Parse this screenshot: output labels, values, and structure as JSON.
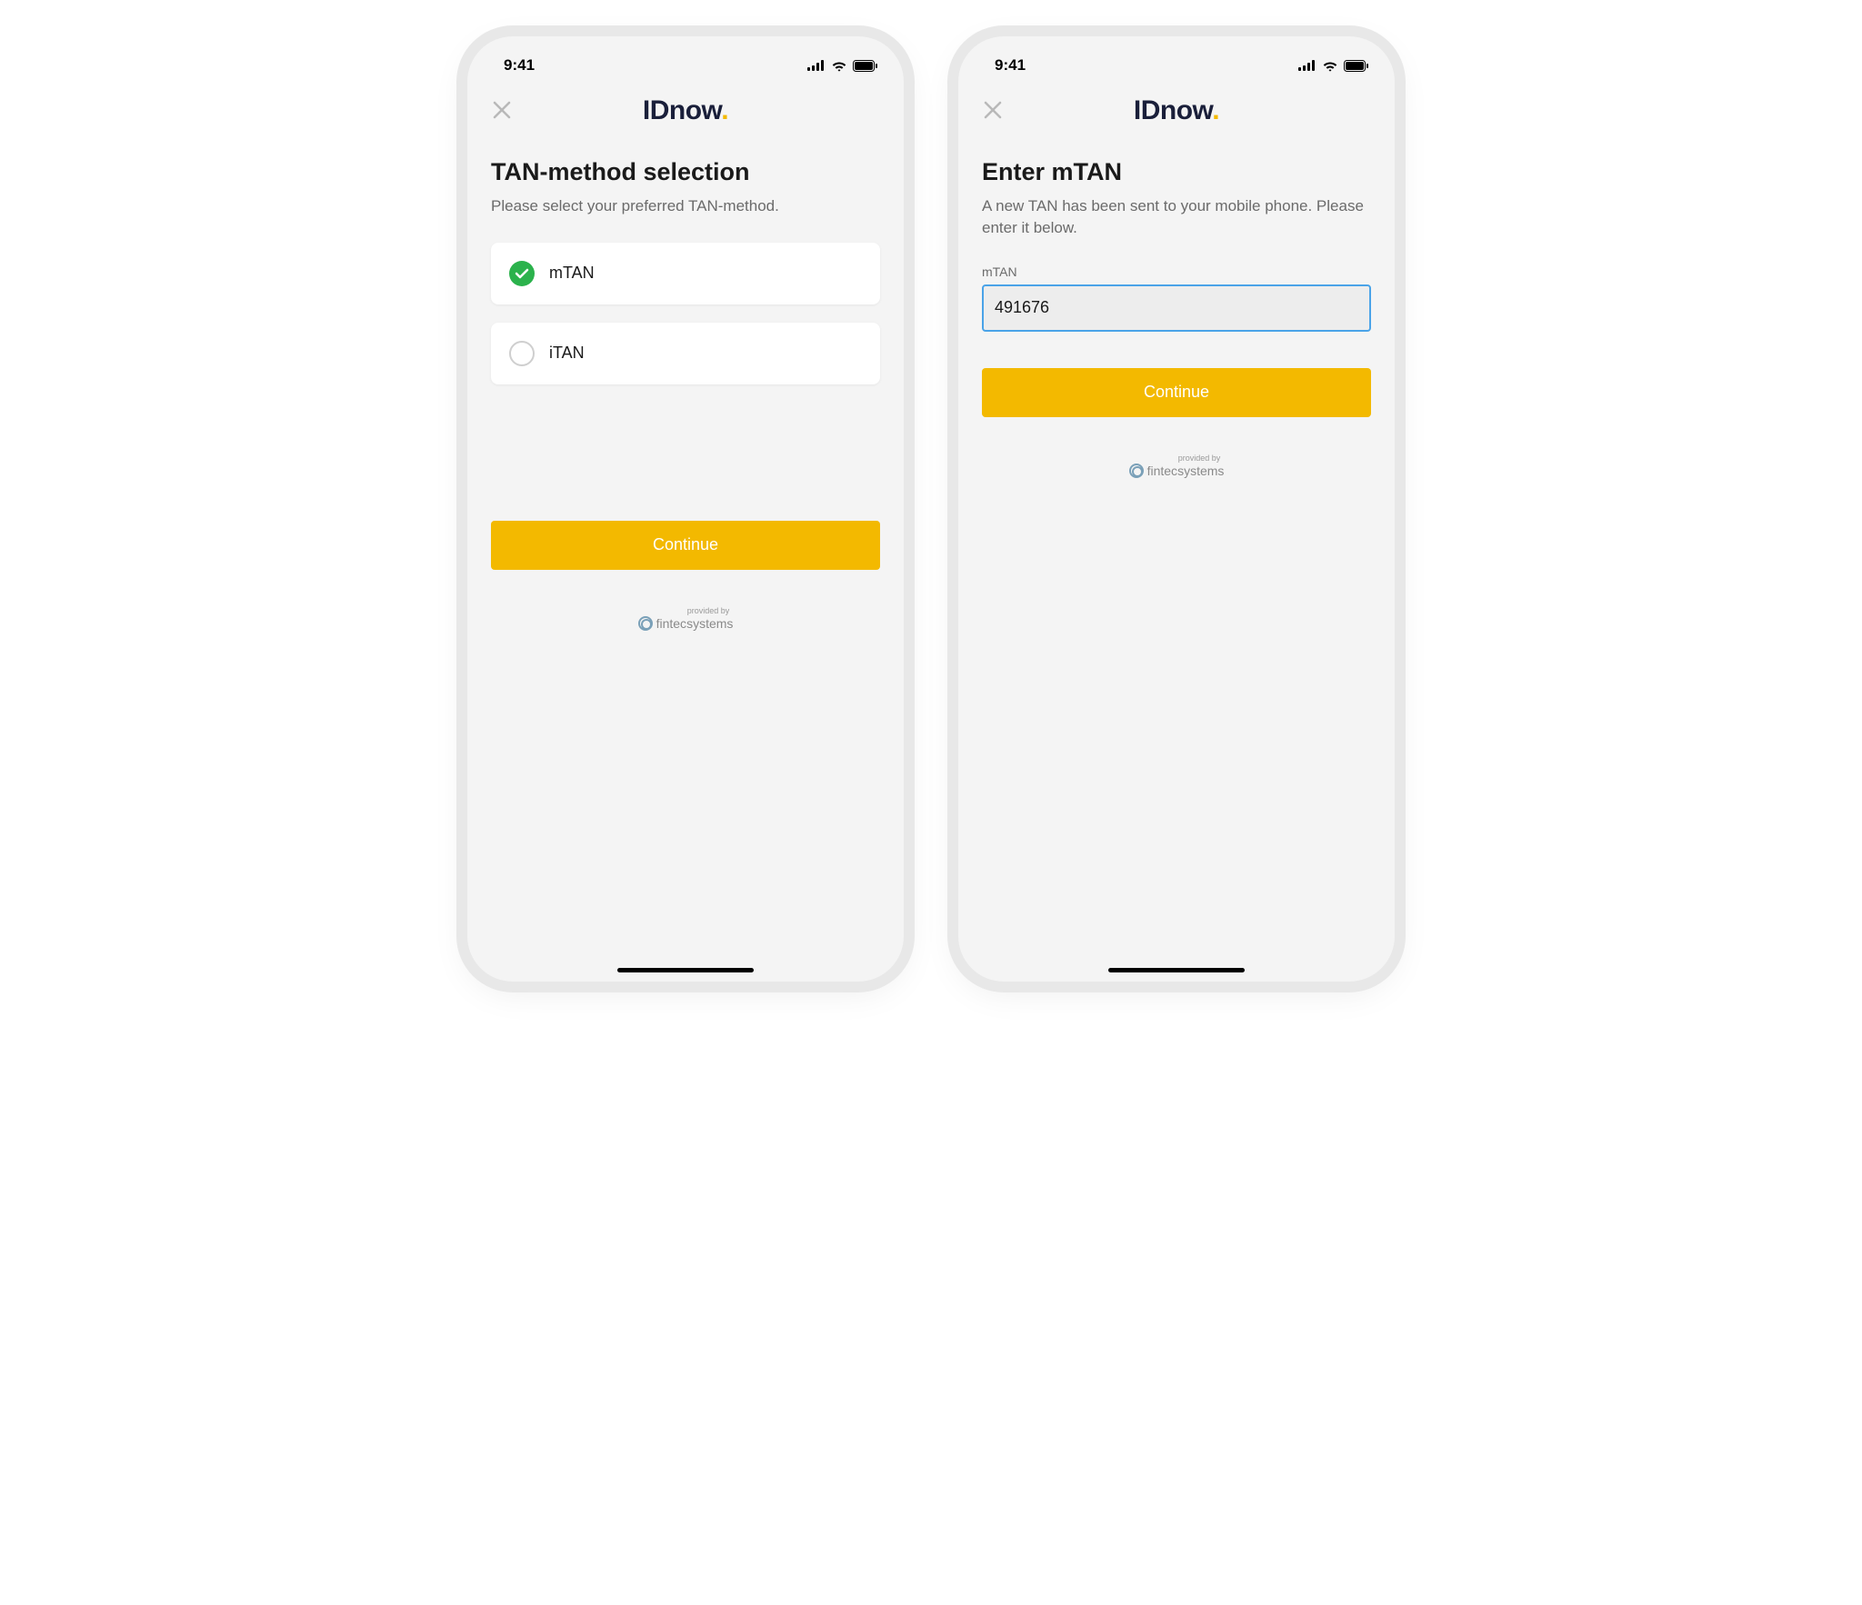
{
  "statusBar": {
    "time": "9:41"
  },
  "brand": {
    "name": "IDnow",
    "dotColor": "#f3b900"
  },
  "screenA": {
    "title": "TAN-method selection",
    "subtitle": "Please select your preferred TAN-method.",
    "options": [
      {
        "label": "mTAN",
        "selected": true
      },
      {
        "label": "iTAN",
        "selected": false
      }
    ],
    "continueLabel": "Continue"
  },
  "screenB": {
    "title": "Enter mTAN",
    "subtitle": "A new TAN has been sent to your mobile phone. Please enter it below.",
    "fieldLabel": "mTAN",
    "fieldValue": "491676",
    "continueLabel": "Continue"
  },
  "provider": {
    "prefix": "provided by",
    "name1": "fintec",
    "name2": "systems"
  },
  "colors": {
    "accent": "#f3b900",
    "success": "#2bb24c",
    "inputBorder": "#4aa3e8"
  }
}
